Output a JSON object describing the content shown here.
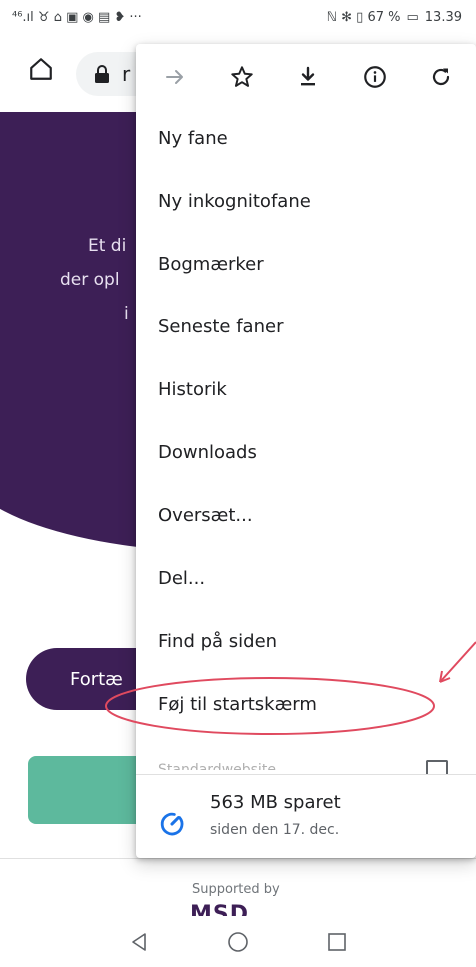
{
  "status_bar": {
    "left_icons": "⁴⁶.ıl ♉ ⌂ ▣ ◉ ▤ ❥ ···",
    "right_text": "ℕ ✻ ▯ 67 %",
    "battery_icon": "▭",
    "time": "13.39"
  },
  "toolbar": {
    "url_fragment": "r"
  },
  "page": {
    "hero_lines": [
      "Et di",
      "der opl",
      "i"
    ],
    "pill_label": "Fortæ",
    "supported_by": "Supported by",
    "logo_text": "MSD"
  },
  "menu": {
    "icons": [
      "forward-icon",
      "star-icon",
      "download-icon",
      "info-icon",
      "refresh-icon"
    ],
    "items": [
      {
        "label": "Ny fane"
      },
      {
        "label": "Ny inkognitofane"
      },
      {
        "label": "Bogmærker"
      },
      {
        "label": "Seneste faner"
      },
      {
        "label": "Historik"
      },
      {
        "label": "Downloads"
      },
      {
        "label": "Oversæt..."
      },
      {
        "label": "Del..."
      },
      {
        "label": "Find på siden"
      },
      {
        "label": "Føj til startskærm"
      }
    ],
    "faded_item": "Standardwebsite",
    "data_saver": {
      "title": "563 MB sparet",
      "subtitle": "siden den 17. dec."
    }
  },
  "colors": {
    "brand_purple": "#3d1f56",
    "green": "#5db99d",
    "annotation_red": "#e04a5f",
    "saver_blue": "#1a73e8"
  }
}
